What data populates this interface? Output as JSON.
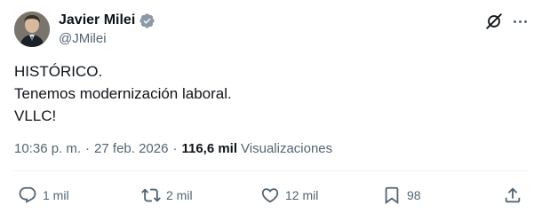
{
  "author": {
    "display_name": "Javier Milei",
    "handle": "@JMilei",
    "verified": true,
    "verified_color": "#8b98a5"
  },
  "tweet": {
    "lines": [
      "HISTÓRICO.",
      "Tenemos modernización laboral.",
      "VLLC!"
    ],
    "time": "10:36 p. m.",
    "separator": "·",
    "date": "27 feb. 2026",
    "views_count": "116,6 mil",
    "views_label": "Visualizaciones"
  },
  "actions": {
    "replies": "1 mil",
    "reposts": "2 mil",
    "likes": "12 mil",
    "bookmarks": "98"
  },
  "icons": {
    "grok": "grok-icon",
    "more": "more-options-icon",
    "reply": "reply-icon",
    "repost": "repost-icon",
    "like": "heart-icon",
    "bookmark": "bookmark-icon",
    "share": "share-icon"
  },
  "colors": {
    "text": "#0f1419",
    "secondary": "#536471",
    "divider": "#eff3f4"
  }
}
